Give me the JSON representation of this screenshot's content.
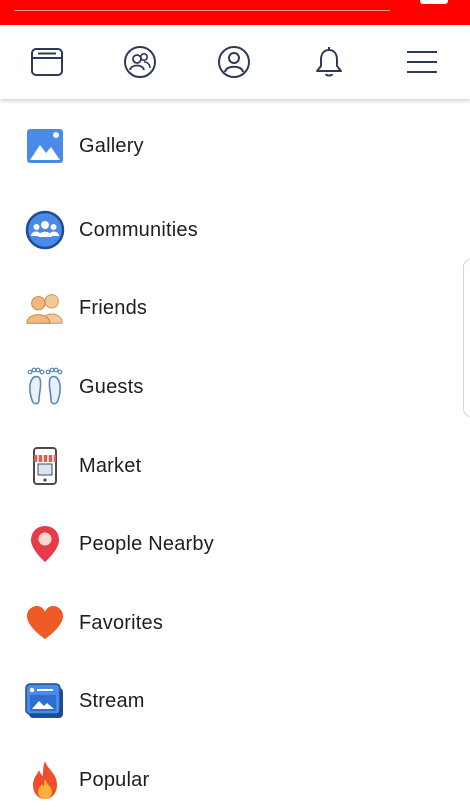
{
  "status_bar": {
    "color": "#ff0000"
  },
  "nav": {
    "icons": [
      "newsfeed-icon",
      "groups-icon",
      "profile-icon",
      "notifications-icon",
      "menu-icon"
    ],
    "accent": "#2d3a57"
  },
  "menu": {
    "items": [
      {
        "label": "Gallery",
        "icon": "gallery-icon"
      },
      {
        "label": "Communities",
        "icon": "communities-icon"
      },
      {
        "label": "Friends",
        "icon": "friends-icon"
      },
      {
        "label": "Guests",
        "icon": "guests-icon"
      },
      {
        "label": "Market",
        "icon": "market-icon"
      },
      {
        "label": "People Nearby",
        "icon": "people-nearby-icon"
      },
      {
        "label": "Favorites",
        "icon": "favorites-icon"
      },
      {
        "label": "Stream",
        "icon": "stream-icon"
      },
      {
        "label": "Popular",
        "icon": "popular-icon"
      }
    ]
  },
  "colors": {
    "brand_blue": "#4a8ae8",
    "heart": "#ee5a24",
    "pin": "#e53b4a",
    "friends": "#f2b880"
  }
}
